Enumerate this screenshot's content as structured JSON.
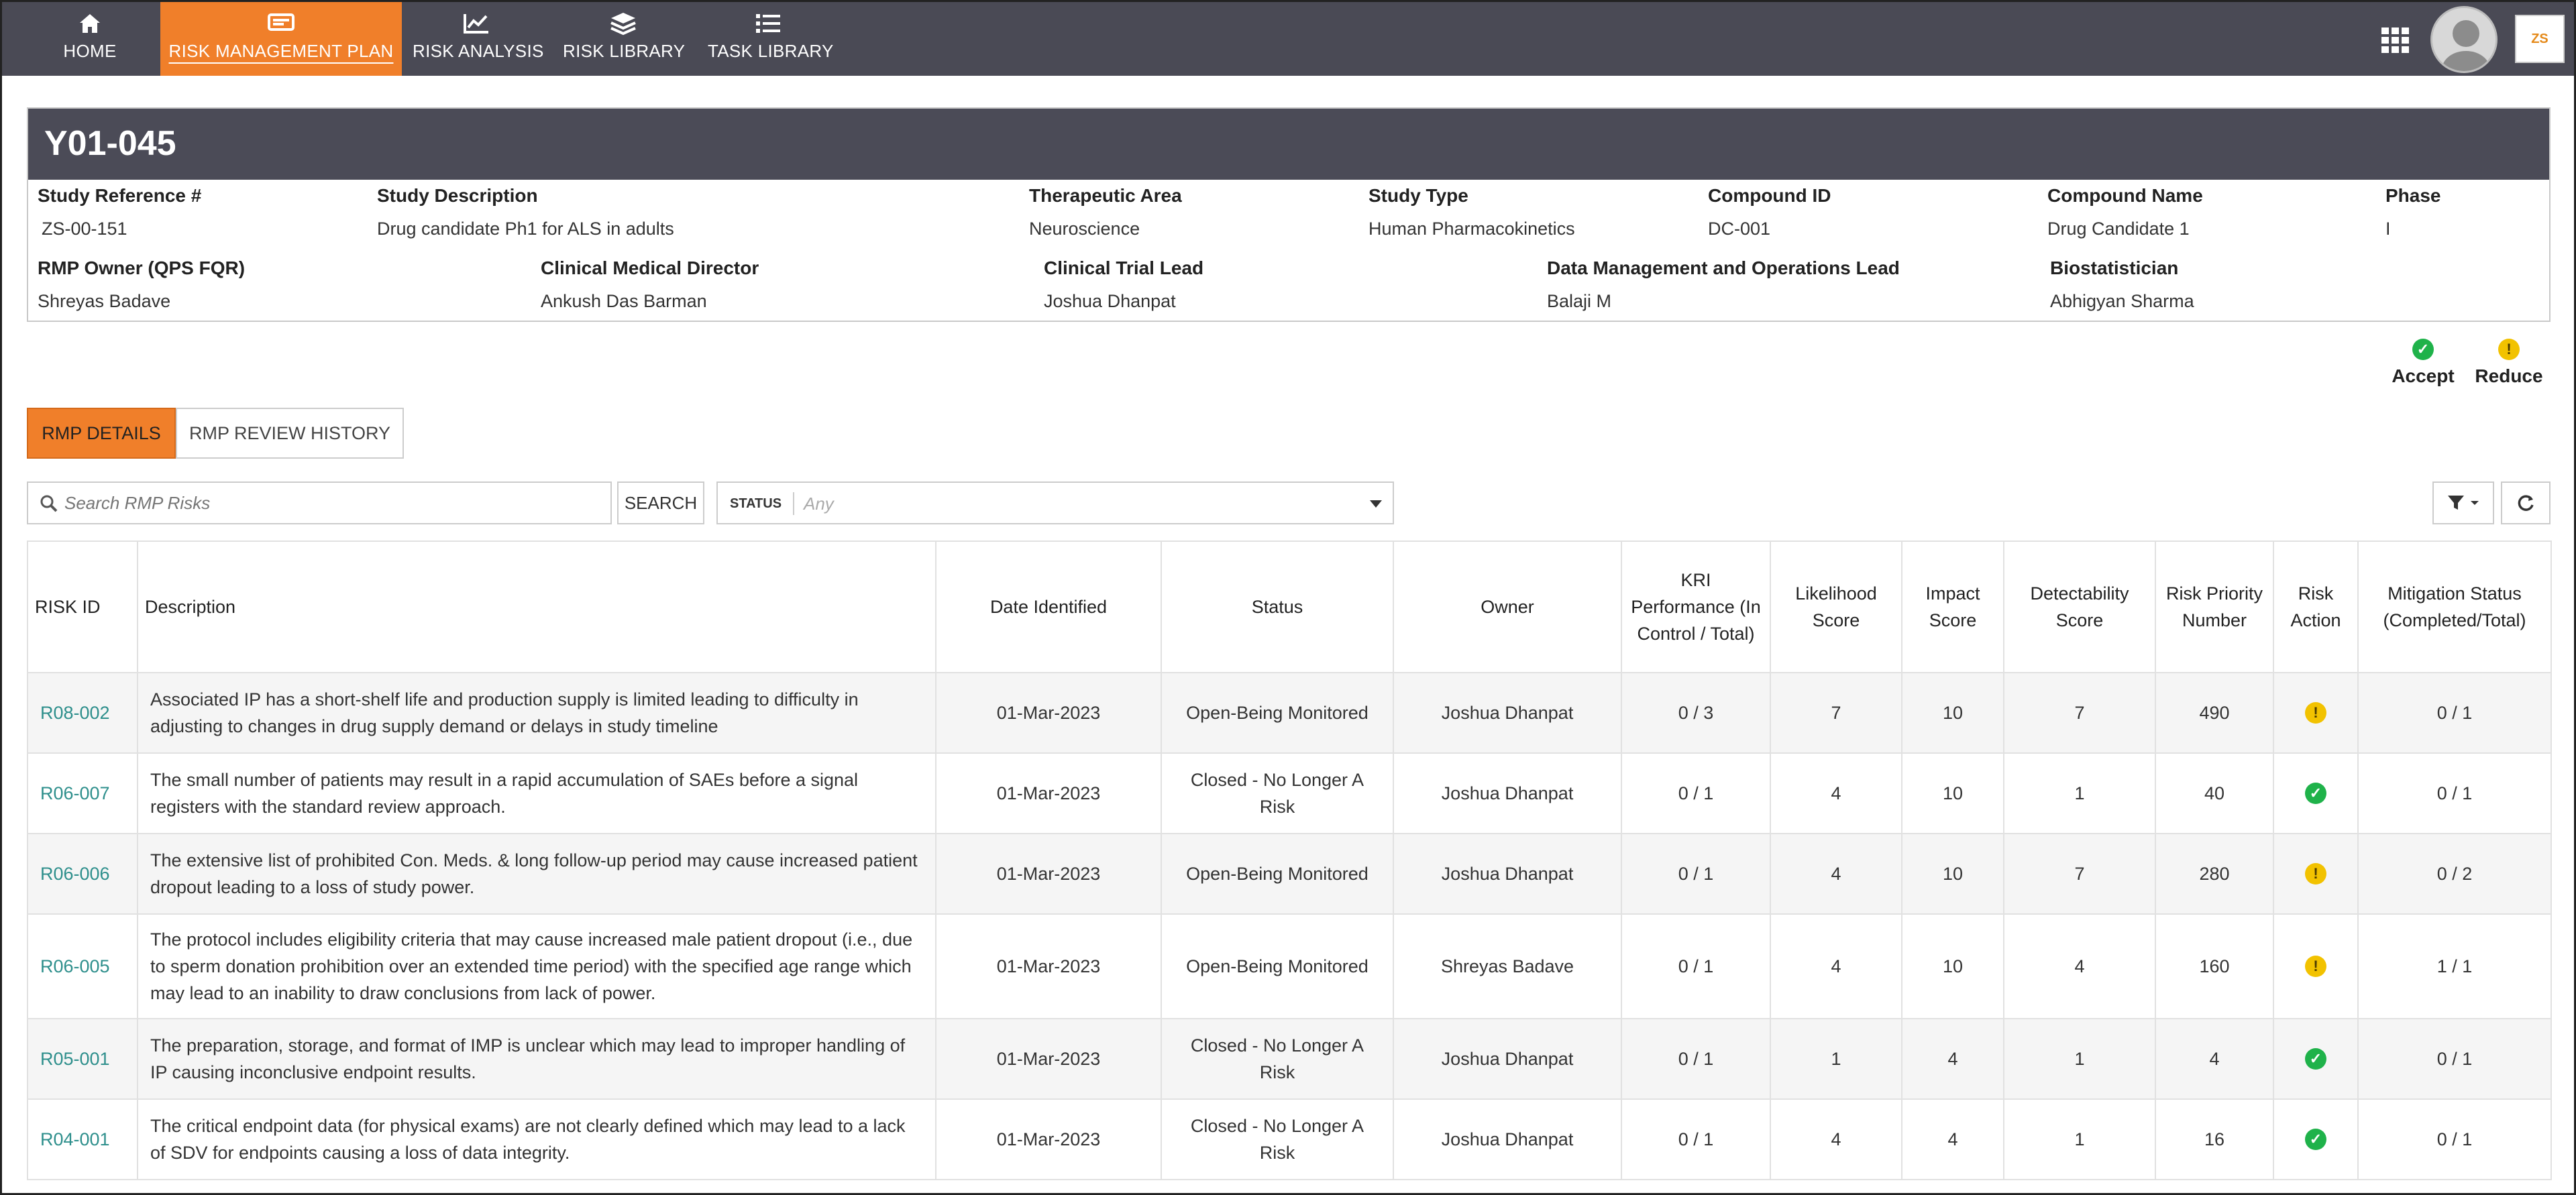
{
  "nav": {
    "items": [
      {
        "label": "HOME",
        "icon": "home-icon"
      },
      {
        "label": "RISK MANAGEMENT PLAN",
        "icon": "plan-icon",
        "active": true
      },
      {
        "label": "RISK ANALYSIS",
        "icon": "chart-icon"
      },
      {
        "label": "RISK LIBRARY",
        "icon": "layers-icon"
      },
      {
        "label": "TASK LIBRARY",
        "icon": "list-icon"
      }
    ],
    "apps_icon": "grid-icon",
    "logo_text": "ZS"
  },
  "study": {
    "title": "Y01-045",
    "row1": [
      {
        "label": "Study Reference #",
        "value": "ZS-00-151"
      },
      {
        "label": "Study Description",
        "value": "Drug candidate Ph1 for ALS in adults"
      },
      {
        "label": "Therapeutic Area",
        "value": "Neuroscience"
      },
      {
        "label": "Study Type",
        "value": "Human Pharmacokinetics"
      },
      {
        "label": "Compound ID",
        "value": "DC-001"
      },
      {
        "label": "Compound Name",
        "value": "Drug Candidate 1"
      },
      {
        "label": "Phase",
        "value": "I"
      }
    ],
    "row2": [
      {
        "label": "RMP Owner (QPS FQR)",
        "value": "Shreyas Badave"
      },
      {
        "label": "Clinical Medical Director",
        "value": "Ankush Das Barman"
      },
      {
        "label": "Clinical Trial Lead",
        "value": "Joshua Dhanpat"
      },
      {
        "label": "Data Management and Operations Lead",
        "value": "Balaji M"
      },
      {
        "label": "Biostatistician",
        "value": "Abhigyan Sharma"
      }
    ]
  },
  "legend": {
    "accept": "Accept",
    "reduce": "Reduce",
    "accept_color": "#1fb24a",
    "reduce_color": "#f2c200"
  },
  "tabs": {
    "details": "RMP DETAILS",
    "history": "RMP REVIEW HISTORY"
  },
  "search": {
    "placeholder": "Search RMP Risks",
    "button": "SEARCH",
    "status_label": "STATUS",
    "status_value": "Any"
  },
  "table": {
    "headers": {
      "risk_id": "RISK ID",
      "description": "Description",
      "date": "Date Identified",
      "status": "Status",
      "owner": "Owner",
      "kri": "KRI Performance (In Control / Total)",
      "likelihood": "Likelihood Score",
      "impact": "Impact Score",
      "detectability": "Detectability Score",
      "rpn": "Risk Priority Number",
      "action": "Risk Action",
      "mitigation": "Mitigation Status (Completed/Total)"
    },
    "rows": [
      {
        "id": "R08-002",
        "description": "Associated IP has a short-shelf life and production supply is limited leading to difficulty in adjusting to changes in drug supply demand or delays in study timeline",
        "date": "01-Mar-2023",
        "status": "Open-Being Monitored",
        "owner": "Joshua Dhanpat",
        "kri": "0 / 3",
        "likelihood": "7",
        "impact": "10",
        "detectability": "7",
        "rpn": "490",
        "action": "reduce",
        "mitigation": "0 / 1"
      },
      {
        "id": "R06-007",
        "description": "The small number of patients may result in a rapid accumulation of SAEs before a signal registers with the standard review approach.",
        "date": "01-Mar-2023",
        "status": "Closed - No Longer A Risk",
        "owner": "Joshua Dhanpat",
        "kri": "0 / 1",
        "likelihood": "4",
        "impact": "10",
        "detectability": "1",
        "rpn": "40",
        "action": "accept",
        "mitigation": "0 / 1"
      },
      {
        "id": "R06-006",
        "description": "The extensive list of prohibited Con. Meds. & long follow-up period may cause increased patient dropout leading to a loss of study power.",
        "date": "01-Mar-2023",
        "status": "Open-Being Monitored",
        "owner": "Joshua Dhanpat",
        "kri": "0 / 1",
        "likelihood": "4",
        "impact": "10",
        "detectability": "7",
        "rpn": "280",
        "action": "reduce",
        "mitigation": "0 / 2"
      },
      {
        "id": "R06-005",
        "description": "The protocol includes eligibility criteria that may cause increased male patient dropout (i.e., due to sperm donation prohibition over an extended time period) with the specified age range which may lead to an inability to draw conclusions from lack of power.",
        "date": "01-Mar-2023",
        "status": "Open-Being Monitored",
        "owner": "Shreyas Badave",
        "kri": "0 / 1",
        "likelihood": "4",
        "impact": "10",
        "detectability": "4",
        "rpn": "160",
        "action": "reduce",
        "mitigation": "1 / 1"
      },
      {
        "id": "R05-001",
        "description": "The preparation, storage, and format of IMP is unclear which may lead to improper handling of IP causing inconclusive endpoint results.",
        "date": "01-Mar-2023",
        "status": "Closed - No Longer A Risk",
        "owner": "Joshua Dhanpat",
        "kri": "0 / 1",
        "likelihood": "1",
        "impact": "4",
        "detectability": "1",
        "rpn": "4",
        "action": "accept",
        "mitigation": "0 / 1"
      },
      {
        "id": "R04-001",
        "description": "The critical endpoint data (for physical exams) are not clearly defined which may lead to a lack of SDV for endpoints causing a loss of data integrity.",
        "date": "01-Mar-2023",
        "status": "Closed - No Longer A Risk",
        "owner": "Joshua Dhanpat",
        "kri": "0 / 1",
        "likelihood": "4",
        "impact": "4",
        "detectability": "1",
        "rpn": "16",
        "action": "accept",
        "mitigation": "0 / 1"
      }
    ]
  }
}
